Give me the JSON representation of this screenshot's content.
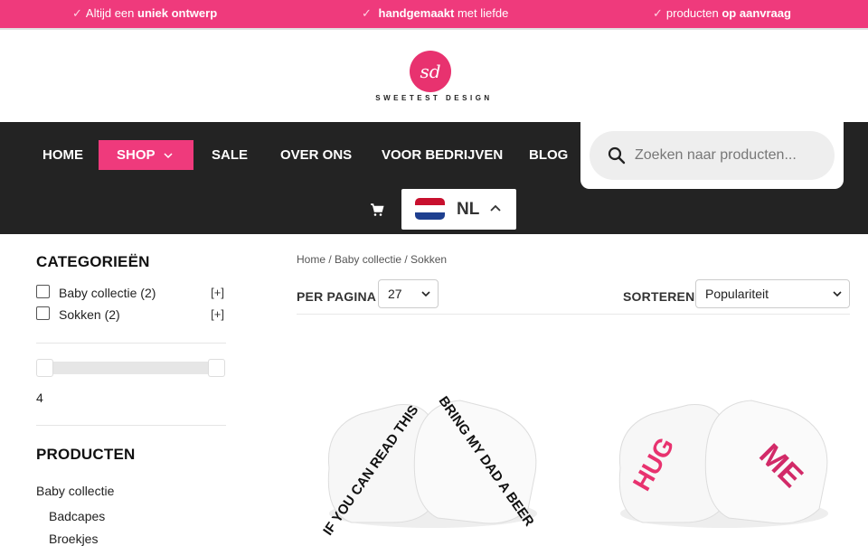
{
  "topbar": {
    "usp1": {
      "pre": "Altijd een",
      "bold": "uniek ontwerp",
      "post": ""
    },
    "usp2": {
      "pre": "",
      "bold": "handgemaakt",
      "post": "met liefde"
    },
    "usp3": {
      "pre": "producten",
      "bold": "op aanvraag",
      "post": ""
    },
    "check": "✓"
  },
  "brand": {
    "monogram": "sd",
    "name": "SWEETEST DESIGN"
  },
  "nav": {
    "items": [
      "HOME",
      "SHOP",
      "SALE",
      "OVER ONS",
      "VOOR BEDRIJVEN",
      "BLOG"
    ],
    "search_placeholder": "Zoeken naar producten...",
    "language": "NL"
  },
  "sidebar": {
    "categories_title": "CATEGORIEËN",
    "categories": [
      {
        "label": "Baby collectie",
        "count": "(2)",
        "expand": "[+]"
      },
      {
        "label": "Sokken",
        "count": "(2)",
        "expand": "[+]"
      }
    ],
    "slider_value": "4",
    "products_title": "PRODUCTEN",
    "products": [
      "Baby collectie",
      "Badcapes",
      "Broekjes"
    ]
  },
  "main": {
    "breadcrumb": "Home / Baby collectie / Sokken",
    "per_page_label": "PER PAGINA",
    "per_page_value": "27",
    "sort_label": "SORTEREN",
    "sort_value": "Populariteit",
    "products": [
      {
        "left_text": "IF YOU CAN READ THIS",
        "right_text": "BRING MY DAD A BEER"
      },
      {
        "left_text": "HUG",
        "right_text": "ME"
      }
    ]
  },
  "colors": {
    "brand_pink": "#ef3a7c",
    "nav_bg": "#232323"
  }
}
